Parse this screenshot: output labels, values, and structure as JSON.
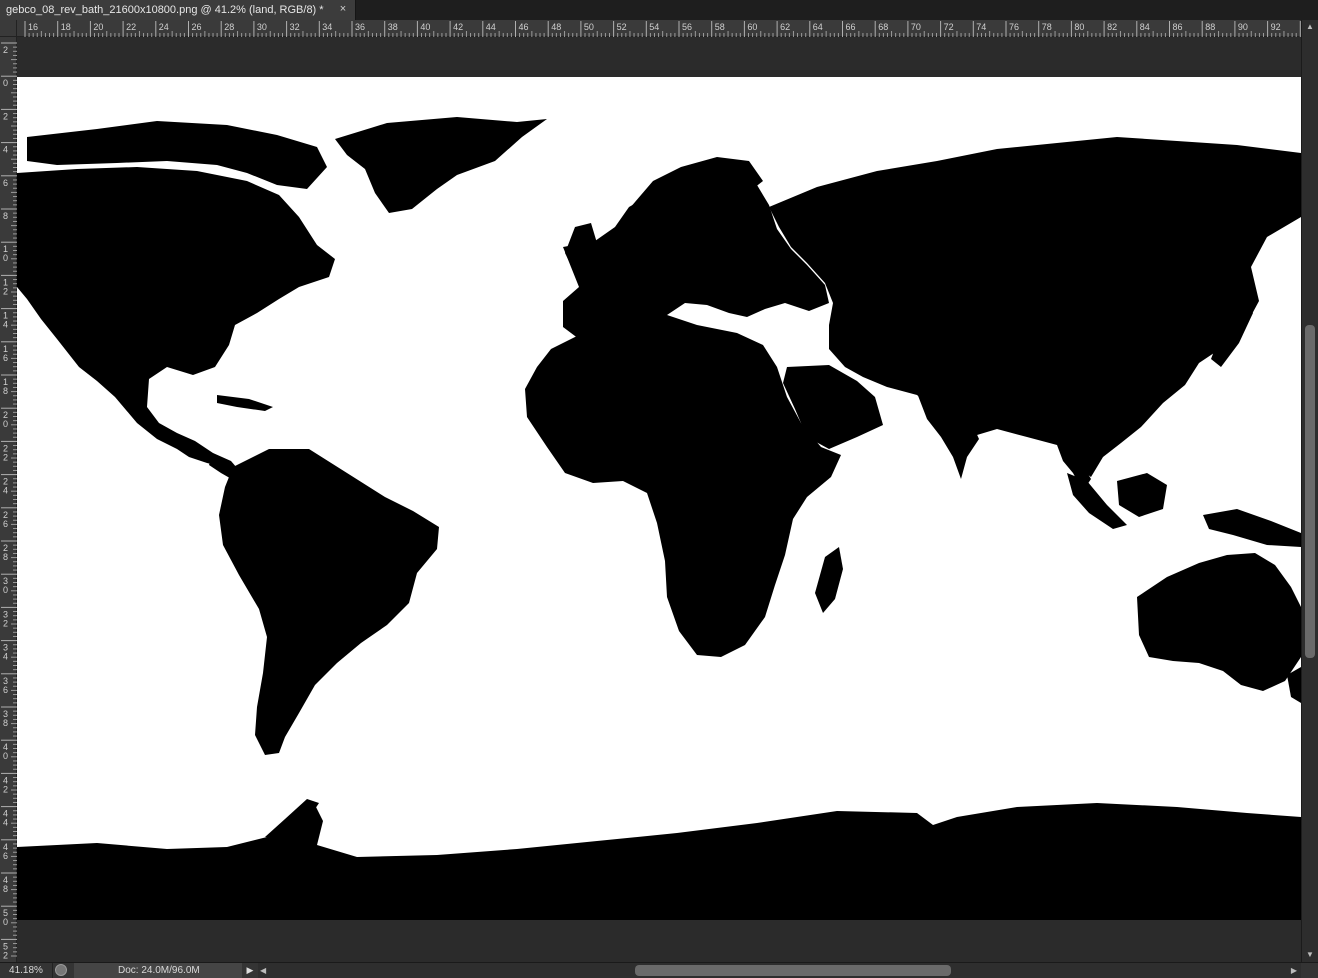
{
  "document_tab": {
    "title": "gebco_08_rev_bath_21600x10800.png @ 41.2% (land, RGB/8) *",
    "close_glyph": "×"
  },
  "rulers": {
    "horizontal_labels": [
      "16",
      "18",
      "20",
      "22",
      "24",
      "26",
      "28",
      "30",
      "32",
      "34",
      "36",
      "38",
      "40",
      "42",
      "44",
      "46",
      "48",
      "50",
      "52",
      "54",
      "56",
      "58",
      "60",
      "62",
      "64",
      "66",
      "68",
      "70",
      "72",
      "74",
      "76",
      "78",
      "80",
      "82",
      "84",
      "86",
      "88",
      "90",
      "92",
      "94"
    ],
    "vertical_labels": [
      "2",
      "0",
      "2",
      "4",
      "6",
      "8",
      "10",
      "12",
      "14",
      "16",
      "18",
      "20",
      "22",
      "24",
      "26",
      "28",
      "30",
      "32",
      "34",
      "36",
      "38",
      "40",
      "42",
      "44",
      "46",
      "48",
      "50",
      "52"
    ]
  },
  "status": {
    "zoom": "41.18%",
    "doc_info": "Doc: 24.0M/96.0M",
    "menu_arrow": "▶"
  },
  "colors": {
    "land": "#000000",
    "ocean": "#ffffff",
    "ui_dark": "#282828"
  }
}
